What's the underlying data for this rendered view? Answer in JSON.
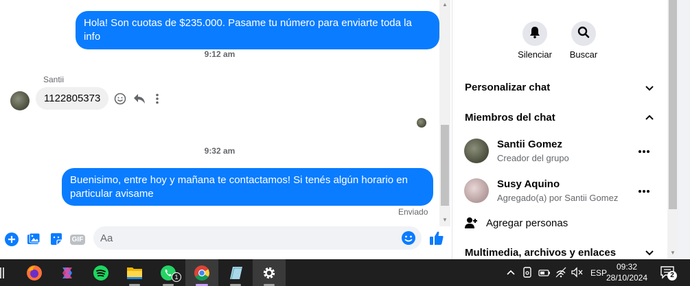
{
  "messages": {
    "msg1": "Hola! Son cuotas de $235.000. Pasame tu número para enviarte toda la info",
    "time1": "9:12 am",
    "sender": "Santii",
    "msg2": "1122805373",
    "time2": "9:32 am",
    "msg3_line1": "Buenisimo, entre hoy y mañana te contactamos! Si tenés algún horario en",
    "msg3_line2": "particular avisame",
    "status": "Enviado"
  },
  "composer": {
    "placeholder": "Aa",
    "gif_label": "GIF"
  },
  "panel": {
    "mute_label": "Silenciar",
    "search_label": "Buscar",
    "customize_label": "Personalizar chat",
    "members_label": "Miembros del chat",
    "members": [
      {
        "name": "Santii Gomez",
        "sub": "Creador del grupo"
      },
      {
        "name": "Susy Aquino",
        "sub": "Agregado(a) por Santii Gomez"
      }
    ],
    "add_people_label": "Agregar personas",
    "media_label": "Multimedia, archivos y enlaces"
  },
  "taskbar": {
    "whatsapp_badge": "1",
    "lang": "ESP",
    "time": "09:32",
    "date": "28/10/2024",
    "notif_count": "2"
  },
  "colors": {
    "accent": "#0a7cff",
    "taskbar": "#1f1f1f"
  }
}
